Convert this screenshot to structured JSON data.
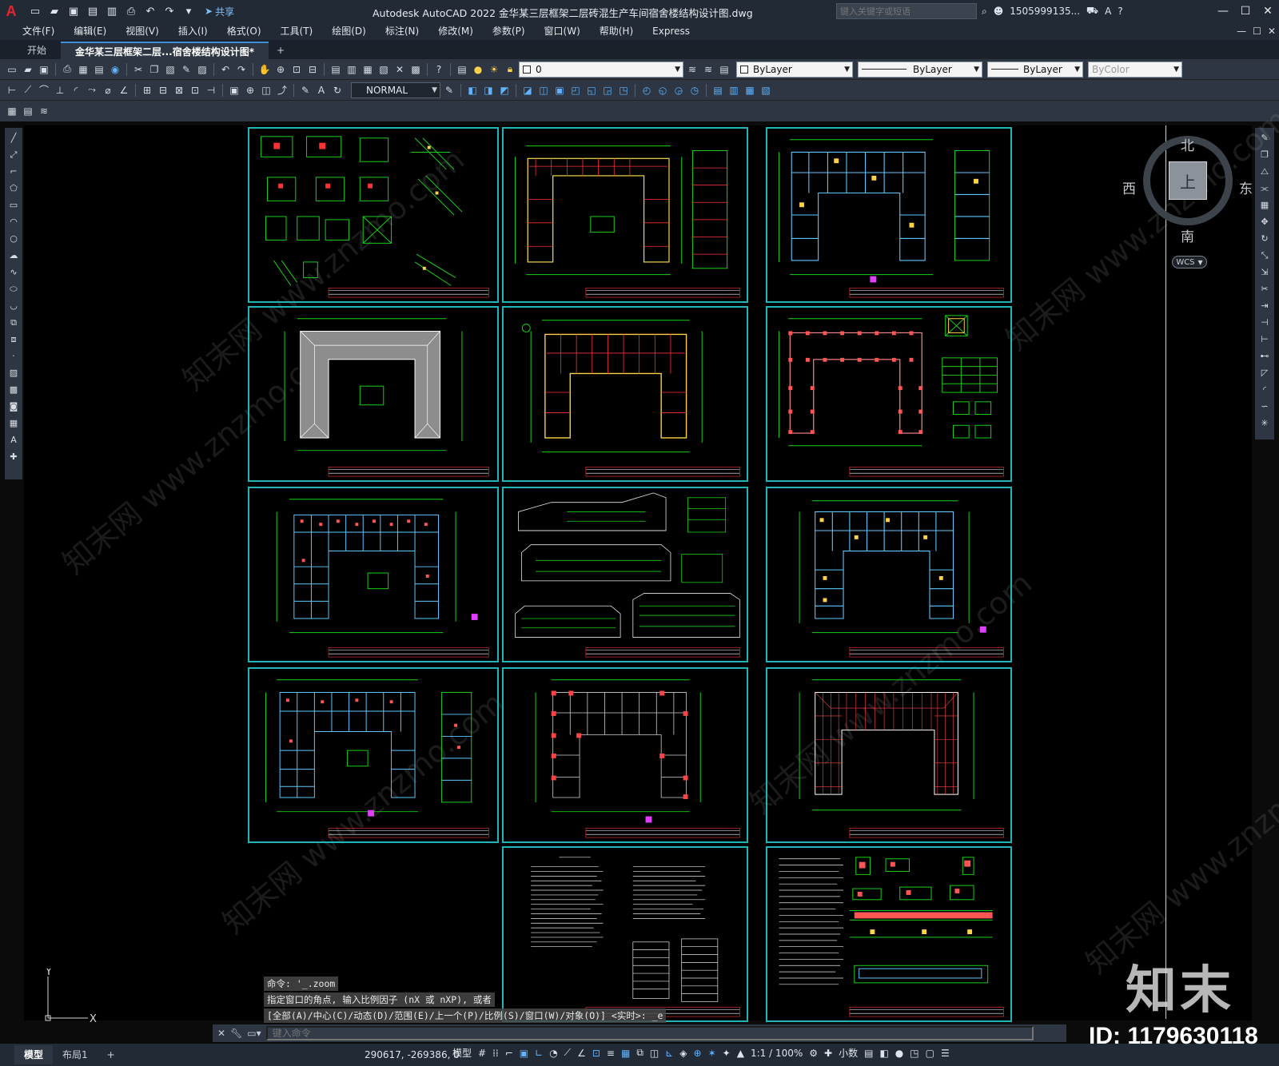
{
  "app": {
    "logo": "A",
    "title": "Autodesk AutoCAD 2022    金华某三层框架二层砖混生产车间宿舍楼结构设计图.dwg",
    "share_label": "共享",
    "search_placeholder": "键入关键字或短语",
    "user": "1505999135...",
    "window_controls": [
      "—",
      "☐",
      "✕"
    ]
  },
  "menu": [
    "文件(F)",
    "编辑(E)",
    "视图(V)",
    "插入(I)",
    "格式(O)",
    "工具(T)",
    "绘图(D)",
    "标注(N)",
    "修改(M)",
    "参数(P)",
    "窗口(W)",
    "帮助(H)",
    "Express"
  ],
  "tabs": {
    "start": "开始",
    "active": "金华某三层框架二层...宿舍楼结构设计图*",
    "add": "+"
  },
  "properties": {
    "layer": "0",
    "color": "ByLayer",
    "linetype": "ByLayer",
    "lineweight": "ByLayer",
    "plotstyle": "ByColor",
    "dimstyle": "NORMAL"
  },
  "viewcube": {
    "north": "北",
    "south": "南",
    "east": "东",
    "west": "西",
    "face": "上",
    "wcs": "WCS"
  },
  "ucs": {
    "x": "X",
    "y": "Y"
  },
  "command_history": [
    "命令: '_.zoom",
    "指定窗口的角点, 输入比例因子 (nX 或 nXP), 或者",
    "[全部(A)/中心(C)/动态(D)/范围(E)/上一个(P)/比例(S)/窗口(W)/对象(O)] <实时>: _e"
  ],
  "command_placeholder": "键入命令",
  "status": {
    "layout_tabs": [
      "模型",
      "布局1"
    ],
    "coords": "290617, -269386, 0",
    "space": "模型",
    "scale": "1:1 / 100%",
    "units": "小数"
  },
  "watermark": {
    "logo": "知末",
    "id": "ID: 1179630118",
    "diag": "知末网 www.znzmo.com"
  },
  "colors": {
    "frame": "#1fb5b9",
    "plan": "#18d018",
    "column": "#ff3333",
    "accent": "#3f8fd8"
  }
}
